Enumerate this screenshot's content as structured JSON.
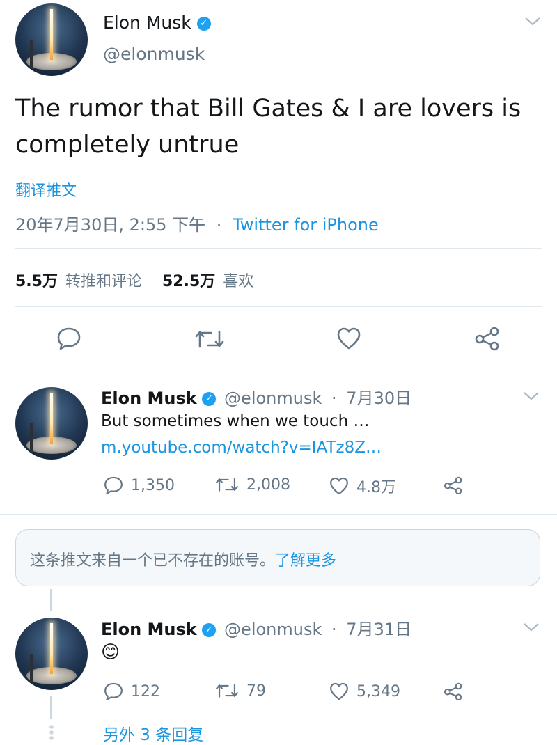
{
  "main_tweet": {
    "display_name": "Elon Musk",
    "handle": "@elonmusk",
    "text": "The rumor that Bill Gates & I are lovers is completely untrue",
    "translate_label": "翻译推文",
    "timestamp": "20年7月30日, 2:55 下午",
    "separator": "·",
    "source": "Twitter for iPhone",
    "retweets_count": "5.5万",
    "retweets_label": "转推和评论",
    "likes_count": "52.5万",
    "likes_label": "喜欢"
  },
  "replies": [
    {
      "display_name": "Elon Musk",
      "handle": "@elonmusk",
      "separator": "·",
      "date": "7月30日",
      "text": "But sometimes when we touch …",
      "link": "m.youtube.com/watch?v=IATz8Z…",
      "reply_count": "1,350",
      "retweet_count": "2,008",
      "like_count": "4.8万"
    },
    {
      "display_name": "Elon Musk",
      "handle": "@elonmusk",
      "separator": "·",
      "date": "7月31日",
      "text": "😊",
      "reply_count": "122",
      "retweet_count": "79",
      "like_count": "5,349"
    }
  ],
  "unavailable_notice": {
    "text": "这条推文来自一个已不存在的账号。",
    "link": "了解更多"
  },
  "more_replies_label": "另外 3 条回复",
  "colors": {
    "accent": "#1da1f2",
    "link": "#1b95e0",
    "muted": "#657786",
    "divider": "#e1e8ed"
  },
  "icons": [
    "verified-badge-icon",
    "chevron-down-icon",
    "reply-icon",
    "retweet-icon",
    "like-icon",
    "share-icon"
  ]
}
